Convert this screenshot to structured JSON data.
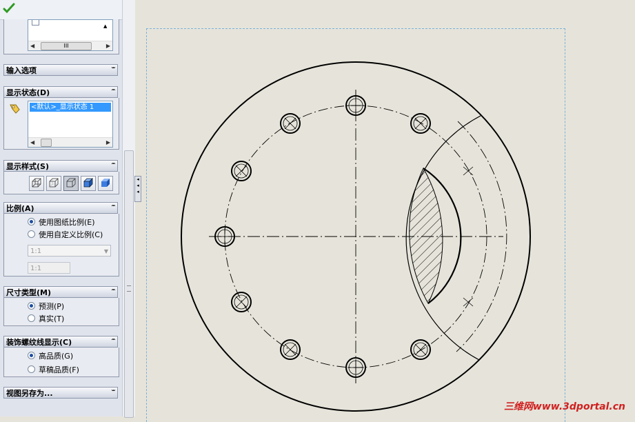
{
  "panel": {
    "top_list": {
      "scroll_label": "III"
    },
    "input_options": {
      "title": "输入选项"
    },
    "display_state": {
      "title": "显示状态(D)",
      "selected_item": "<默认>_显示状态 1"
    },
    "display_style": {
      "title": "显示样式(S)"
    },
    "scale": {
      "title": "比例(A)",
      "option_sheet": "使用图纸比例(E)",
      "option_custom": "使用自定义比例(C)",
      "combo_value": "1:1",
      "box_value": "1:1"
    },
    "dimension_type": {
      "title": "尺寸类型(M)",
      "option_projected": "预测(P)",
      "option_true": "真实(T)"
    },
    "thread_display": {
      "title": "装饰螺纹线显示(C)",
      "option_high": "高品质(G)",
      "option_draft": "草稿品质(F)"
    },
    "save_view_as": {
      "title": "视图另存为..."
    }
  },
  "watermark": "三维网www.3dportal.cn",
  "colors": {
    "accent_selection": "#3399ff",
    "sheet_border": "#7ab0d8",
    "drawing_bg": "#e6e4da"
  }
}
